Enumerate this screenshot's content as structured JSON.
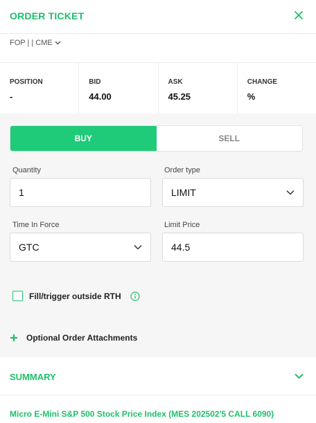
{
  "header": {
    "title": "ORDER TICKET"
  },
  "symbol": {
    "label": "FOP | | CME"
  },
  "quote": {
    "position_label": "POSITION",
    "position_value": "-",
    "bid_label": "BID",
    "bid_value": "44.00",
    "ask_label": "ASK",
    "ask_value": "45.25",
    "change_label": "CHANGE",
    "change_value": "%"
  },
  "side": {
    "buy_label": "BUY",
    "sell_label": "SELL",
    "selected": "BUY"
  },
  "quantity": {
    "label": "Quantity",
    "value": "1"
  },
  "order_type": {
    "label": "Order type",
    "value": "LIMIT"
  },
  "tif": {
    "label": "Time In Force",
    "value": "GTC"
  },
  "limit_price": {
    "label": "Limit Price",
    "value": "44.5"
  },
  "rth": {
    "label": "Fill/trigger outside RTH",
    "checked": false
  },
  "attachments": {
    "label": "Optional Order Attachments"
  },
  "summary": {
    "title": "SUMMARY"
  },
  "contract": {
    "description": "Micro E-Mini S&P 500 Stock Price Index (MES 202502'5 CALL 6090)"
  },
  "colors": {
    "accent": "#1fbf6b",
    "buy": "#1fcb79"
  }
}
